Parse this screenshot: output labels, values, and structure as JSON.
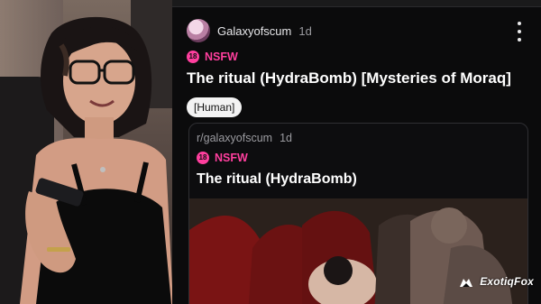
{
  "post": {
    "author": "Galaxyofscum",
    "age": "1d",
    "nsfw_label": "NSFW",
    "nsfw_badge": "18",
    "title": "The ritual (HydraBomb) [Mysteries of Moraq]",
    "flair": "[Human]"
  },
  "crosspost": {
    "subreddit": "r/galaxyofscum",
    "age": "1d",
    "nsfw_label": "NSFW",
    "nsfw_badge": "18",
    "title": "The ritual (HydraBomb)"
  },
  "watermark": {
    "text": "ExotiqFox"
  },
  "icons": {
    "more": "more-vertical-icon",
    "nsfw": "nsfw-18-badge-icon"
  },
  "colors": {
    "nsfw": "#ff3f9e",
    "background": "#0b0b0c",
    "flair_bg": "#f3f3f3"
  }
}
